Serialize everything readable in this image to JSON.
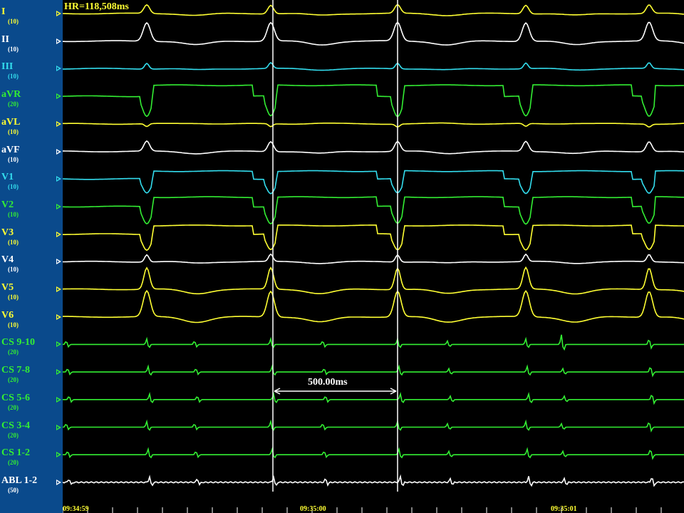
{
  "heart_rate_readout": "HR=118,508ms",
  "caliper": {
    "label": "500.00ms"
  },
  "leads": [
    {
      "name": "I",
      "gain": "(10)",
      "color": "#ffff33"
    },
    {
      "name": "II",
      "gain": "(10)",
      "color": "#ffffff"
    },
    {
      "name": "III",
      "gain": "(10)",
      "color": "#33ddee"
    },
    {
      "name": "aVR",
      "gain": "(20)",
      "color": "#33ee33"
    },
    {
      "name": "aVL",
      "gain": "(10)",
      "color": "#ffff33"
    },
    {
      "name": "aVF",
      "gain": "(10)",
      "color": "#ffffff"
    },
    {
      "name": "V1",
      "gain": "(10)",
      "color": "#33ddee"
    },
    {
      "name": "V2",
      "gain": "(10)",
      "color": "#33ee33"
    },
    {
      "name": "V3",
      "gain": "(10)",
      "color": "#ffff33"
    },
    {
      "name": "V4",
      "gain": "(10)",
      "color": "#ffffff"
    },
    {
      "name": "V5",
      "gain": "(10)",
      "color": "#ffff33"
    },
    {
      "name": "V6",
      "gain": "(10)",
      "color": "#ffff33"
    },
    {
      "name": "CS 9-10",
      "gain": "(20)",
      "color": "#33ee33"
    },
    {
      "name": "CS 7-8",
      "gain": "(20)",
      "color": "#33ee33"
    },
    {
      "name": "CS 5-6",
      "gain": "(20)",
      "color": "#33ee33"
    },
    {
      "name": "CS 3-4",
      "gain": "(20)",
      "color": "#33ee33"
    },
    {
      "name": "CS 1-2",
      "gain": "(20)",
      "color": "#33ee33"
    },
    {
      "name": "ABL 1-2",
      "gain": "(50)",
      "color": "#ffffff"
    }
  ],
  "time_labels": [
    "09:34:59",
    "09:35:00",
    "09:35:01"
  ],
  "colors": {
    "sidebar": "#0a4a8c",
    "background": "#000000",
    "caliper": "#ffffff",
    "timestamps": "#ffff33"
  }
}
